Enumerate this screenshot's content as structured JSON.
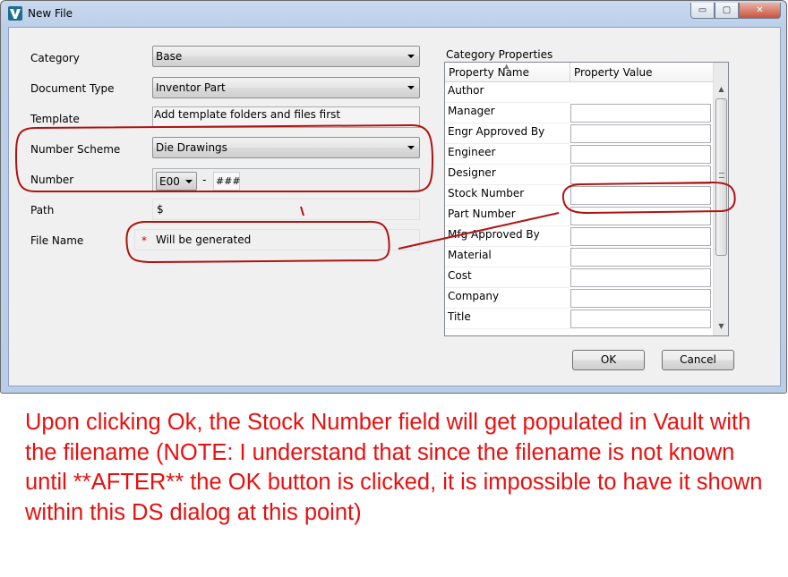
{
  "window": {
    "title": "New File",
    "minimize_glyph": "▭",
    "maximize_glyph": "▢",
    "close_glyph": "✕"
  },
  "form": {
    "category_label": "Category",
    "category_value": "Base",
    "document_type_label": "Document Type",
    "document_type_value": "Inventor Part",
    "template_label": "Template",
    "template_value": "Add template folders and files first",
    "number_scheme_label": "Number Scheme",
    "number_scheme_value": "Die Drawings",
    "number_label": "Number",
    "number_prefix": "E00",
    "number_separator": "-",
    "number_pattern": "###",
    "path_label": "Path",
    "path_value": "$",
    "file_name_label": "File Name",
    "file_name_required": "*",
    "file_name_value": "Will be generated"
  },
  "category_properties": {
    "title": "Category Properties",
    "col_name": "Property Name",
    "col_value": "Property Value",
    "rows": [
      {
        "name": "Author",
        "has_field": false
      },
      {
        "name": "Manager",
        "has_field": true
      },
      {
        "name": "Engr Approved By",
        "has_field": true
      },
      {
        "name": "Engineer",
        "has_field": true
      },
      {
        "name": "Designer",
        "has_field": true
      },
      {
        "name": "Stock Number",
        "has_field": true
      },
      {
        "name": "Part Number",
        "has_field": true
      },
      {
        "name": "Mfg Approved By",
        "has_field": true
      },
      {
        "name": "Material",
        "has_field": true
      },
      {
        "name": "Cost",
        "has_field": true
      },
      {
        "name": "Company",
        "has_field": true
      },
      {
        "name": "Title",
        "has_field": true
      }
    ]
  },
  "buttons": {
    "ok": "OK",
    "cancel": "Cancel"
  },
  "annotation": {
    "text": "Upon clicking Ok, the Stock Number field will get populated in Vault with the filename (NOTE: I understand that since the filename is not known until **AFTER** the OK button is clicked, it is impossible to have it shown within this DS dialog at this point)",
    "color": "#e8100f"
  },
  "colors": {
    "accent_frame": "#b9cde8",
    "annotation_outline": "#b01212"
  }
}
